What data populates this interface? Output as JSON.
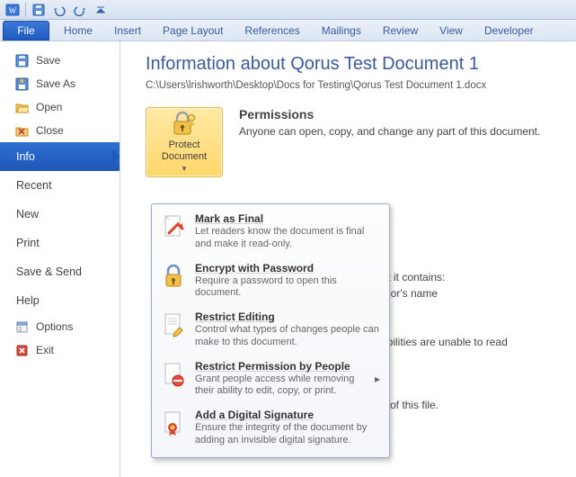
{
  "qat": {
    "tip_save": "Save",
    "tip_undo": "Undo",
    "tip_redo": "Redo"
  },
  "ribbon": {
    "file": "File",
    "tabs": [
      "Home",
      "Insert",
      "Page Layout",
      "References",
      "Mailings",
      "Review",
      "View",
      "Developer"
    ]
  },
  "side": {
    "save": "Save",
    "save_as": "Save As",
    "open": "Open",
    "close": "Close",
    "info": "Info",
    "recent": "Recent",
    "new": "New",
    "print": "Print",
    "save_send": "Save & Send",
    "help": "Help",
    "options": "Options",
    "exit": "Exit"
  },
  "info": {
    "title": "Information about Qorus Test Document 1",
    "path": "C:\\Users\\lrishworth\\Desktop\\Docs for Testing\\Qorus Test Document 1.docx",
    "protect_btn": "Protect Document",
    "perm_title": "Permissions",
    "perm_text": "Anyone can open, copy, and change any part of this document."
  },
  "menu": {
    "items": [
      {
        "title": "Mark as Final",
        "desc": "Let readers know the document is final and make it read-only."
      },
      {
        "title": "Encrypt with Password",
        "desc": "Require a password to open this document."
      },
      {
        "title": "Restrict Editing",
        "desc": "Control what types of changes people can make to this document."
      },
      {
        "title": "Restrict Permission by People",
        "desc": "Grant people access while removing their ability to edit, copy, or print."
      },
      {
        "title": "Add a Digital Signature",
        "desc": "Ensure the integrity of the document by adding an invisible digital signature."
      }
    ]
  },
  "bg": {
    "prepare_head": "",
    "contains_tail": "hat it contains:",
    "author_tail": "uthor's name",
    "access_tail": "sabilities are unable to read",
    "versions_tail": "ns of this file."
  }
}
